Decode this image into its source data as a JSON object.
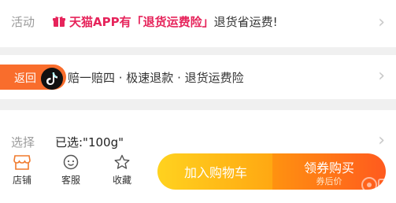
{
  "activity": {
    "label": "活动",
    "highlight": "天猫APP有「退货运费险」",
    "tail": "退货省运费!"
  },
  "service": {
    "tab_label": "返回",
    "text": "赔一赔四 · 极速退款 · 退货运费险"
  },
  "select": {
    "label": "选择",
    "value": "已选:\"100g\""
  },
  "bottom_bar": {
    "tabs": [
      {
        "label": "店铺",
        "icon": "store-icon"
      },
      {
        "label": "客服",
        "icon": "chat-face-icon"
      },
      {
        "label": "收藏",
        "icon": "star-icon"
      }
    ],
    "cart_button": "加入购物车",
    "buy_button": "领券购买",
    "buy_sub": "券后价"
  },
  "colors": {
    "accent_pink": "#e6245b",
    "return_orange": "#f96d2c",
    "cart_yellow": "#ffb816",
    "buy_orange": "#ff6a1a"
  }
}
